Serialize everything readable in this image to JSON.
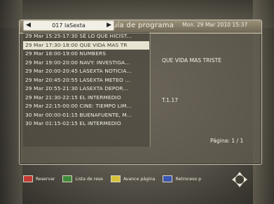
{
  "title": "Guía de programa",
  "channel": {
    "name": "017 laSexta",
    "left_arrow": "◀",
    "right_arrow": "▶"
  },
  "datetime": "Mon.  29 Mar 2010 15:37",
  "programs": [
    "29 Mar 15:25-17:30  SÉ LO QUE HICIST...",
    "29 Mar 17:30-18:00  QUE VIDA MAS TR",
    "29 Mar 18:00-19:00  NUMBERS",
    "29 Mar 19:00-20:00  NAVY: INVESTIGA...",
    "29 Mar 20:00-20:45  LASEXTA NOTICIA...",
    "29 Mar 20:45-20:55  LASEXTA METEO ...",
    "29 Mar 20:55-21:30  LASEXTA DEPOR...",
    "29 Mar 21:30-22:15  EL INTERMEDIO",
    "29 Mar 22:15-00:00  CINE: TIEMPO LIM...",
    "30 Mar 00:00-01:15  BUENAFUENTE, M...",
    "30 Mar 01:15-02:15  EL INTERMEDIO"
  ],
  "selected_index": 1,
  "details": {
    "title": "QUE VIDA MAS TRISTE",
    "code": "T.1.17"
  },
  "page": "Página: 1 / 1",
  "footer": [
    {
      "label": "Reservar",
      "color": "#c23a32"
    },
    {
      "label": "Lista de rese",
      "color": "#3f8a3a"
    },
    {
      "label": "Avance página",
      "color": "#d6c23a"
    },
    {
      "label": "Retroceso p",
      "color": "#3a56b0"
    }
  ]
}
